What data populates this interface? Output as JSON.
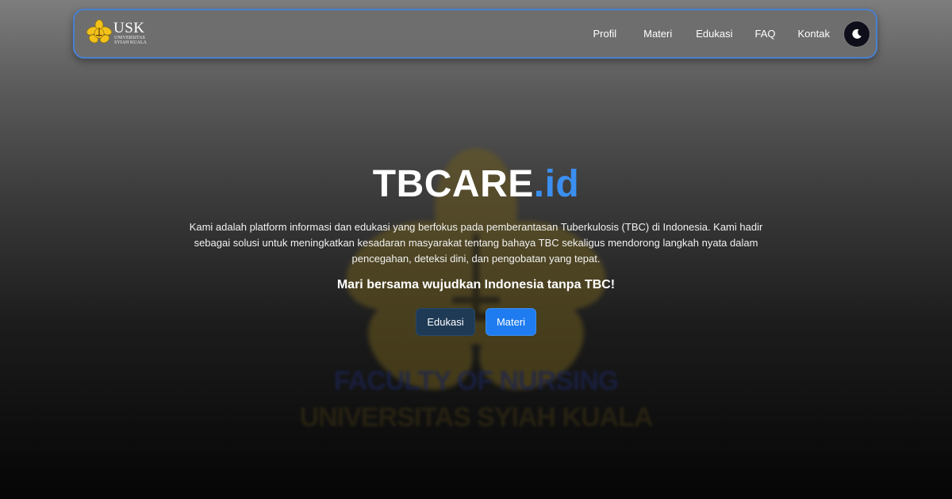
{
  "nav": {
    "brand": {
      "name": "USK",
      "subtitle_line1": "UNIVERSITAS",
      "subtitle_line2": "SYIAH KUALA"
    },
    "links": [
      {
        "label": "Profil"
      },
      {
        "label": "Materi"
      },
      {
        "label": "Edukasi"
      },
      {
        "label": "FAQ"
      },
      {
        "label": "Kontak"
      }
    ],
    "theme_toggle_icon": "moon-icon",
    "border_color": "#4a7fd0"
  },
  "hero": {
    "title_main": "TBCARE",
    "title_accent": ".id",
    "accent_color": "#3b8ff0",
    "description": "Kami adalah platform informasi dan edukasi yang berfokus pada pemberantasan Tuberkulosis (TBC) di Indonesia. Kami hadir sebagai solusi untuk meningkatkan kesadaran masyarakat tentang bahaya TBC sekaligus mendorong langkah nyata dalam pencegahan, deteksi dini, dan pengobatan yang tepat.",
    "tagline": "Mari bersama wujudkan Indonesia tanpa TBC!",
    "buttons": {
      "edukasi": "Edukasi",
      "materi": "Materi"
    }
  },
  "background": {
    "logo_icon": "usk-flower-emblem-icon",
    "line1": "FACULTY OF NURSING",
    "line2": "UNIVERSITAS SYIAH KUALA"
  }
}
